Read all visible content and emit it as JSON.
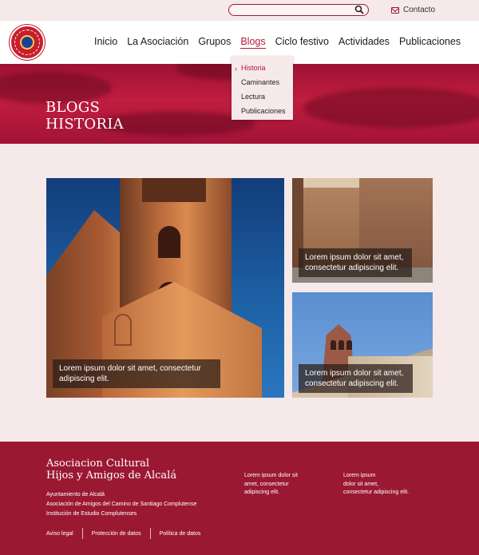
{
  "topbar": {
    "search_placeholder": "",
    "contact_label": "Contacto"
  },
  "nav": {
    "items": [
      "Inicio",
      "La Asociación",
      "Grupos",
      "Blogs",
      "Ciclo festivo",
      "Actividades",
      "Publicaciones"
    ],
    "active": "Blogs"
  },
  "dropdown": {
    "items": [
      "Historia",
      "Caminantes",
      "Lectura",
      "Publicaciones"
    ],
    "active": "Historia"
  },
  "hero": {
    "line1": "BLOGS",
    "line2": "HISTORIA"
  },
  "cards": [
    {
      "caption": "Lorem ipsum dolor sit amet,  consectetur adipiscing elit."
    },
    {
      "caption": "Lorem ipsum dolor sit amet, consectetur adipiscing elit."
    },
    {
      "caption": "Lorem ipsum dolor sit amet, consectetur adipiscing elit."
    }
  ],
  "footer": {
    "title_line1": "Asociacion Cultural",
    "title_line2": "Hijos y Amigos de Alcalá",
    "lines": [
      "Ayuntamiento de Alcalá",
      "Asociación de Amigos del  Camino de Santiago Complutense",
      "Institución de Estudio Complutenses"
    ],
    "col2": [
      "Lorem ipsum dolor sit",
      "amet, consectetur",
      "adipiscing elit."
    ],
    "col3": [
      "Lorem ipsum",
      "dolor sit amet,",
      "consectetur adipiscing elit."
    ],
    "links": [
      "Aviso legal",
      "Protección de datos",
      "Política de datos"
    ]
  },
  "colors": {
    "brand": "#9b1833",
    "accent": "#b5173a",
    "background": "#f6e9ea"
  }
}
